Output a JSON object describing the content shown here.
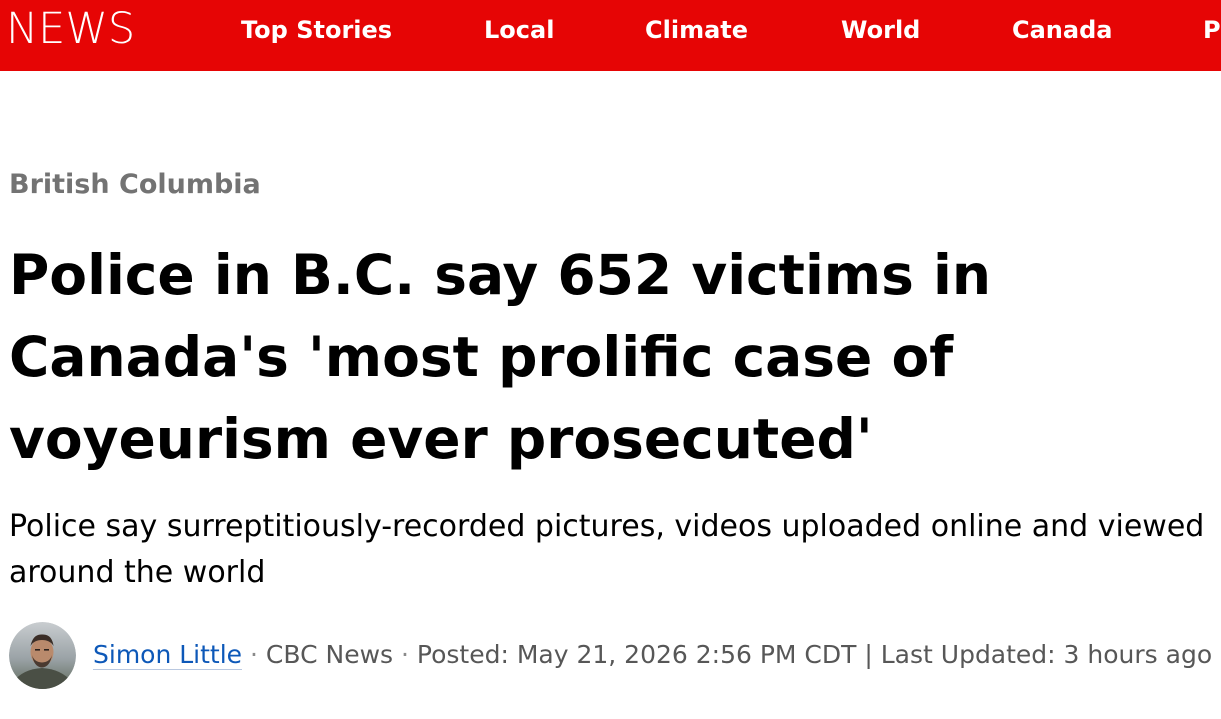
{
  "header": {
    "brand": "NEWS",
    "nav": [
      {
        "label": "Top Stories"
      },
      {
        "label": "Local"
      },
      {
        "label": "Climate"
      },
      {
        "label": "World"
      },
      {
        "label": "Canada"
      },
      {
        "label": "P"
      }
    ]
  },
  "article": {
    "section": "British Columbia",
    "headline": "Police in B.C. say 652 victims in Canada's 'most prolific case of voyeurism ever prosecuted'",
    "deck": "Police say surreptitiously-recorded pictures, videos uploaded online and viewed around the world",
    "byline": {
      "author": "Simon Little",
      "separator": "·",
      "outlet": "CBC News",
      "posted": "Posted: May 21, 2026 2:56 PM CDT",
      "divider": "|",
      "updated": "Last Updated: 3 hours ago"
    }
  },
  "colors": {
    "brand_red": "#e60505",
    "section_gray": "#737373",
    "author_link_blue": "#0d58b8",
    "meta_gray": "#575757"
  },
  "icons": {
    "author_avatar": "author-avatar-photo"
  }
}
